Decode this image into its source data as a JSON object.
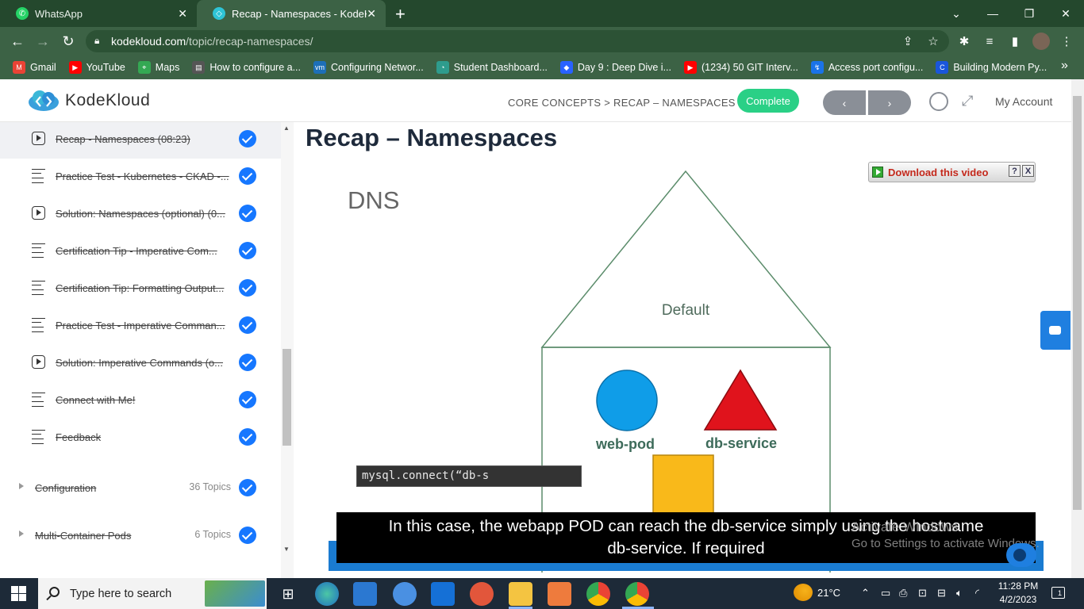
{
  "browser": {
    "tabs": [
      {
        "title": "WhatsApp",
        "icon": "whatsapp-icon",
        "active": false
      },
      {
        "title": "Recap - Namespaces - KodeKloud",
        "icon": "kodekloud-icon",
        "active": true
      }
    ],
    "url_host": "kodekloud.com",
    "url_path": "/topic/recap-namespaces/",
    "bookmarks": [
      {
        "label": "Gmail",
        "icon": "gmail-icon",
        "color": "#ea4335"
      },
      {
        "label": "YouTube",
        "icon": "youtube-icon",
        "color": "#ff0000"
      },
      {
        "label": "Maps",
        "icon": "maps-icon",
        "color": "#34a853"
      },
      {
        "label": "How to configure a...",
        "icon": "page-icon",
        "color": "#555555"
      },
      {
        "label": "Configuring Networ...",
        "icon": "vmware-icon",
        "color": "#1d6fb8"
      },
      {
        "label": "Student Dashboard...",
        "icon": "dashboard-icon",
        "color": "#2e9c8d"
      },
      {
        "label": "Day 9 : Deep Dive i...",
        "icon": "diamond-icon",
        "color": "#2962ff"
      },
      {
        "label": "(1234) 50 GIT Interv...",
        "icon": "youtube-icon",
        "color": "#ff0000"
      },
      {
        "label": "Access port configu...",
        "icon": "link-icon",
        "color": "#1a73e8"
      },
      {
        "label": "Building Modern Py...",
        "icon": "c-icon",
        "color": "#1a56db"
      }
    ],
    "bookmarks_more": "»"
  },
  "site": {
    "brand": "KodeKloud",
    "breadcrumb": "CORE CONCEPTS > RECAP – NAMESPACES",
    "complete_label": "Complete",
    "prev_label": "‹",
    "next_label": "›",
    "account_label": "My Account",
    "accent_color": "#2ad086"
  },
  "sidebar": {
    "lessons": [
      {
        "title": "Recap - Namespaces (08:23)",
        "type": "video",
        "done": true,
        "active": true
      },
      {
        "title": "Practice Test - Kubernetes - CKAD -...",
        "type": "doc",
        "done": true
      },
      {
        "title": "Solution: Namespaces (optional) (0...",
        "type": "video",
        "done": true
      },
      {
        "title": "Certification Tip - Imperative Com...",
        "type": "doc",
        "done": true
      },
      {
        "title": "Certification Tip: Formatting Output...",
        "type": "doc",
        "done": true
      },
      {
        "title": "Practice Test - Imperative Comman...",
        "type": "doc",
        "done": true
      },
      {
        "title": "Solution: Imperative Commands (o...",
        "type": "video",
        "done": true
      },
      {
        "title": "Connect with Me!",
        "type": "doc",
        "done": true
      },
      {
        "title": "Feedback",
        "type": "doc",
        "done": true
      }
    ],
    "sections": [
      {
        "title": "Configuration",
        "count": "36 Topics",
        "done": true
      },
      {
        "title": "Multi-Container Pods",
        "count": "6 Topics",
        "done": true
      }
    ]
  },
  "main": {
    "title": "Recap – Namespaces",
    "download_label": "Download this video",
    "download_help": "?",
    "download_close": "X",
    "slide": {
      "heading": "DNS",
      "namespace_label": "Default",
      "pod_label": "web-pod",
      "service_label": "db-service",
      "code": "mysql.connect(“db-s",
      "pod_color": "#0f9de8",
      "service_color": "#e0131c",
      "box_color": "#f9b91a",
      "outline_color": "#5b8c6b"
    },
    "caption_line1": "In this case, the webapp POD can reach the db-service simply using the hostname",
    "caption_line2": "db-service. If required",
    "watermark_line1": "Activate Windows",
    "watermark_line2": "Go to Settings to activate Windows."
  },
  "taskbar": {
    "search_placeholder": "Type here to search",
    "temperature": "21°C",
    "time": "11:28 PM",
    "date": "4/2/2023",
    "notification_count": "1"
  }
}
